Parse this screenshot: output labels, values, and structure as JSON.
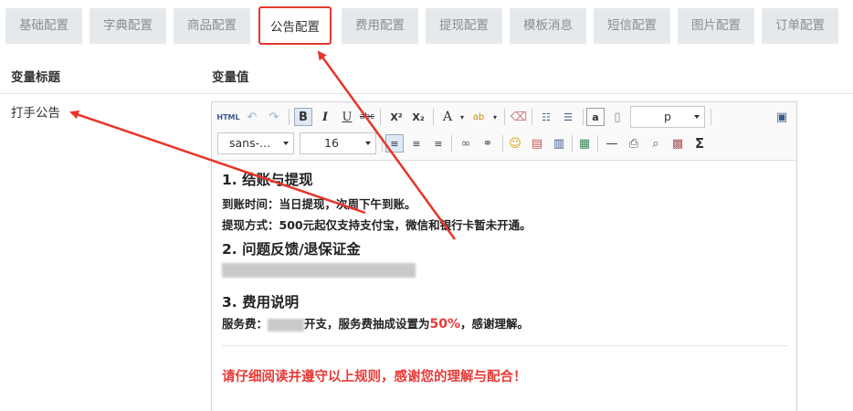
{
  "tabs": [
    {
      "label": "基础配置"
    },
    {
      "label": "字典配置"
    },
    {
      "label": "商品配置"
    },
    {
      "label": "公告配置"
    },
    {
      "label": "费用配置"
    },
    {
      "label": "提现配置"
    },
    {
      "label": "模板消息"
    },
    {
      "label": "短信配置"
    },
    {
      "label": "图片配置"
    },
    {
      "label": "订单配置"
    }
  ],
  "table": {
    "col_title": "变量标题",
    "col_value": "变量值",
    "row_label": "打手公告"
  },
  "toolbar": {
    "html_label": "HTML",
    "bold": "B",
    "italic": "I",
    "underline": "U",
    "strike": "abc",
    "superscript": "X²",
    "subscript": "X₂",
    "fontcolor": "A",
    "paragraph_value": "p",
    "font_family_value": "sans-...",
    "font_size_value": "16",
    "sum": "Σ"
  },
  "content": {
    "h1": "1. 结账与提现",
    "line1": "到账时间：当日提现，次周下午到账。",
    "line2": "提现方式：500元起仅支持支付宝，微信和银行卡暂未开通。",
    "h2": "2. 问题反馈/退保证金",
    "h3": "3. 费用说明",
    "fee_prefix": "服务费：",
    "fee_mid": "开支，服务费抽成设置为",
    "fee_percent": "50%",
    "fee_suffix": "，感谢理解。",
    "notice": "请仔细阅读并遵守以上规则，感谢您的理解与配合！"
  },
  "colors": {
    "accent_red": "#e33b2e",
    "notice_red": "#e83a36",
    "tab_bg": "#e6e9ec"
  }
}
